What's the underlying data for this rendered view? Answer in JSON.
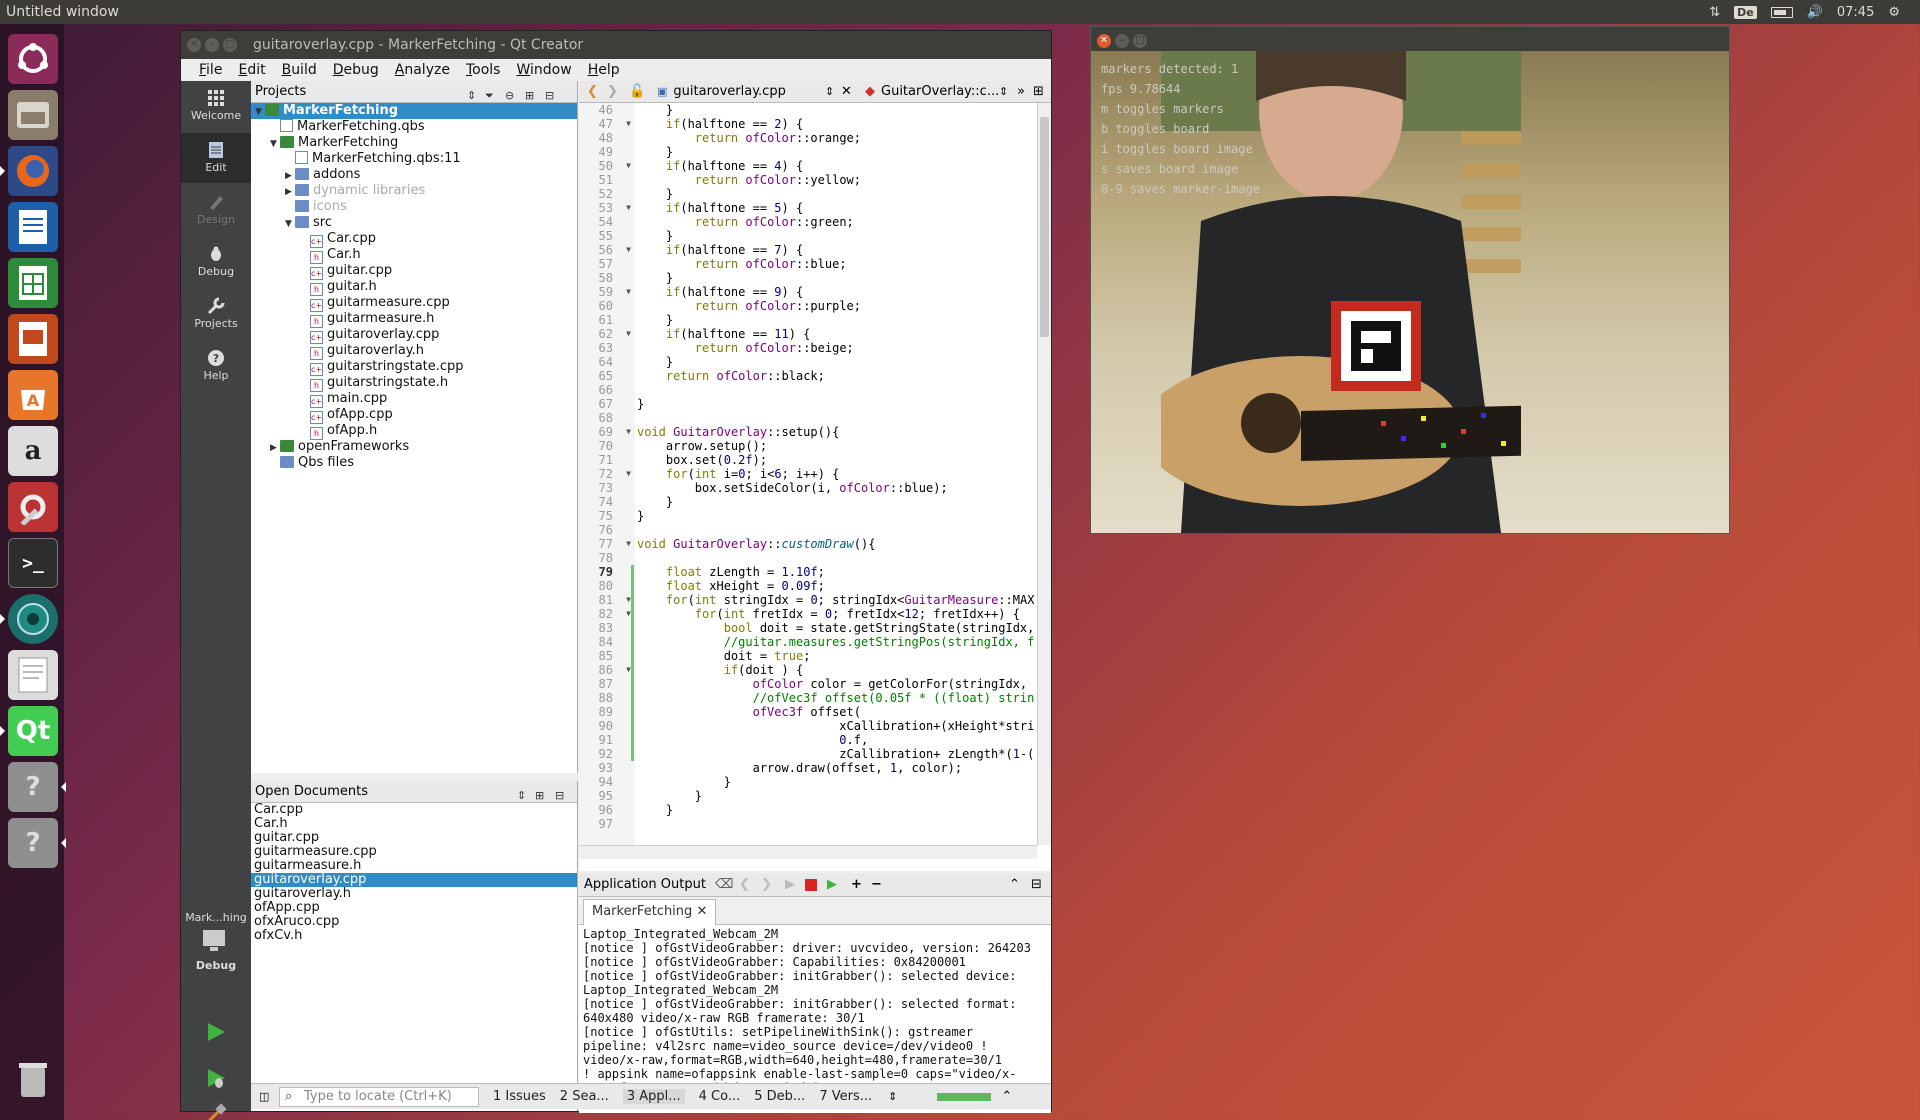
{
  "topbar": {
    "window_title": "Untitled window",
    "keyboard": "De",
    "time": "07:45"
  },
  "launcher": {
    "items": [
      "Ubuntu",
      "Files",
      "Firefox",
      "Writer",
      "Calc",
      "Impress",
      "Software",
      "Amazon",
      "Settings",
      "Terminal",
      "Qt Creator",
      "Text Editor",
      "Qt",
      "Help",
      "Help",
      "Trash"
    ]
  },
  "qt": {
    "title": "guitaroverlay.cpp - MarkerFetching - Qt Creator",
    "menu": [
      "File",
      "Edit",
      "Build",
      "Debug",
      "Analyze",
      "Tools",
      "Window",
      "Help"
    ],
    "modes": [
      "Welcome",
      "Edit",
      "Design",
      "Debug",
      "Projects",
      "Help"
    ],
    "target_kit": "Mark...hing",
    "target_mode": "Debug",
    "projects_label": "Projects",
    "tree": [
      {
        "label": "MarkerFetching",
        "level": 0,
        "sel": true,
        "tri": "▼",
        "type": "proj"
      },
      {
        "label": "MarkerFetching.qbs",
        "level": 1,
        "tri": "",
        "type": "file"
      },
      {
        "label": "MarkerFetching",
        "level": 1,
        "tri": "▼",
        "type": "proj"
      },
      {
        "label": "MarkerFetching.qbs:11",
        "level": 2,
        "tri": "",
        "type": "file"
      },
      {
        "label": "addons",
        "level": 2,
        "tri": "▶",
        "type": "folder"
      },
      {
        "label": "dynamic libraries",
        "level": 2,
        "tri": "▶",
        "type": "folder",
        "dim": true
      },
      {
        "label": "icons",
        "level": 2,
        "tri": "",
        "type": "folder",
        "dim": true
      },
      {
        "label": "src",
        "level": 2,
        "tri": "▼",
        "type": "folder"
      },
      {
        "label": "Car.cpp",
        "level": 3,
        "tri": "",
        "type": "cpp"
      },
      {
        "label": "Car.h",
        "level": 3,
        "tri": "",
        "type": "h"
      },
      {
        "label": "guitar.cpp",
        "level": 3,
        "tri": "",
        "type": "cpp"
      },
      {
        "label": "guitar.h",
        "level": 3,
        "tri": "",
        "type": "h"
      },
      {
        "label": "guitarmeasure.cpp",
        "level": 3,
        "tri": "",
        "type": "cpp"
      },
      {
        "label": "guitarmeasure.h",
        "level": 3,
        "tri": "",
        "type": "h"
      },
      {
        "label": "guitaroverlay.cpp",
        "level": 3,
        "tri": "",
        "type": "cpp"
      },
      {
        "label": "guitaroverlay.h",
        "level": 3,
        "tri": "",
        "type": "h"
      },
      {
        "label": "guitarstringstate.cpp",
        "level": 3,
        "tri": "",
        "type": "cpp"
      },
      {
        "label": "guitarstringstate.h",
        "level": 3,
        "tri": "",
        "type": "h"
      },
      {
        "label": "main.cpp",
        "level": 3,
        "tri": "",
        "type": "cpp"
      },
      {
        "label": "ofApp.cpp",
        "level": 3,
        "tri": "",
        "type": "cpp"
      },
      {
        "label": "ofApp.h",
        "level": 3,
        "tri": "",
        "type": "h"
      },
      {
        "label": "openFrameworks",
        "level": 1,
        "tri": "▶",
        "type": "proj"
      },
      {
        "label": "Qbs files",
        "level": 1,
        "tri": "",
        "type": "folder"
      }
    ],
    "open_docs_label": "Open Documents",
    "open_docs": [
      "Car.cpp",
      "Car.h",
      "guitar.cpp",
      "guitarmeasure.cpp",
      "guitarmeasure.h",
      "guitaroverlay.cpp",
      "guitaroverlay.h",
      "ofApp.cpp",
      "ofxAruco.cpp",
      "ofxCv.h"
    ],
    "open_docs_selected": 5,
    "editor_file": "guitaroverlay.cpp",
    "editor_symbol": "GuitarOverlay::c...",
    "code_lines": [
      {
        "n": "46",
        "t": "    }"
      },
      {
        "n": "47",
        "t": "    if(halftone == 2) {",
        "f": true
      },
      {
        "n": "48",
        "t": "        return ofColor::orange;"
      },
      {
        "n": "49",
        "t": "    }"
      },
      {
        "n": "50",
        "t": "    if(halftone == 4) {",
        "f": true
      },
      {
        "n": "51",
        "t": "        return ofColor::yellow;"
      },
      {
        "n": "52",
        "t": "    }"
      },
      {
        "n": "53",
        "t": "    if(halftone == 5) {",
        "f": true
      },
      {
        "n": "54",
        "t": "        return ofColor::green;"
      },
      {
        "n": "55",
        "t": "    }"
      },
      {
        "n": "56",
        "t": "    if(halftone == 7) {",
        "f": true
      },
      {
        "n": "57",
        "t": "        return ofColor::blue;"
      },
      {
        "n": "58",
        "t": "    }"
      },
      {
        "n": "59",
        "t": "    if(halftone == 9) {",
        "f": true
      },
      {
        "n": "60",
        "t": "        return ofColor::purple;"
      },
      {
        "n": "61",
        "t": "    }"
      },
      {
        "n": "62",
        "t": "    if(halftone == 11) {",
        "f": true
      },
      {
        "n": "63",
        "t": "        return ofColor::beige;"
      },
      {
        "n": "64",
        "t": "    }"
      },
      {
        "n": "65",
        "t": "    return ofColor::black;"
      },
      {
        "n": "66",
        "t": ""
      },
      {
        "n": "67",
        "t": "}"
      },
      {
        "n": "68",
        "t": ""
      },
      {
        "n": "69",
        "t": "void GuitarOverlay::setup(){",
        "f": true
      },
      {
        "n": "70",
        "t": "    arrow.setup();"
      },
      {
        "n": "71",
        "t": "    box.set(0.2f);"
      },
      {
        "n": "72",
        "t": "    for(int i=0; i<6; i++) {",
        "f": true
      },
      {
        "n": "73",
        "t": "        box.setSideColor(i, ofColor::blue);"
      },
      {
        "n": "74",
        "t": "    }"
      },
      {
        "n": "75",
        "t": "}"
      },
      {
        "n": "76",
        "t": ""
      },
      {
        "n": "77",
        "t": "void GuitarOverlay::customDraw(){",
        "f": true
      },
      {
        "n": "78",
        "t": ""
      },
      {
        "n": "79",
        "t": "    float zLength = 1.10f;",
        "cur": true
      },
      {
        "n": "80",
        "t": "    float xHeight = 0.09f;"
      },
      {
        "n": "81",
        "t": "    for(int stringIdx = 0; stringIdx<GuitarMeasure::MAX",
        "f": true
      },
      {
        "n": "82",
        "t": "        for(int fretIdx = 0; fretIdx<12; fretIdx++) {",
        "f": true
      },
      {
        "n": "83",
        "t": "            bool doit = state.getStringState(stringIdx,"
      },
      {
        "n": "84",
        "t": "            //guitar.measures.getStringPos(stringIdx, f"
      },
      {
        "n": "85",
        "t": "            doit = true;"
      },
      {
        "n": "86",
        "t": "            if(doit ) {",
        "f": true
      },
      {
        "n": "87",
        "t": "                ofColor color = getColorFor(stringIdx,"
      },
      {
        "n": "88",
        "t": "                //ofVec3f offset(0.05f * ((float) strin"
      },
      {
        "n": "89",
        "t": "                ofVec3f offset("
      },
      {
        "n": "90",
        "t": "                            xCallibration+(xHeight*stri"
      },
      {
        "n": "91",
        "t": "                            0.f,"
      },
      {
        "n": "92",
        "t": "                            zCallibration+ zLength*(1-("
      },
      {
        "n": "93",
        "t": "                arrow.draw(offset, 1, color);"
      },
      {
        "n": "94",
        "t": "            }"
      },
      {
        "n": "95",
        "t": "        }"
      },
      {
        "n": "96",
        "t": "    }"
      },
      {
        "n": "97",
        "t": ""
      }
    ],
    "output_label": "Application Output",
    "output_tab": "MarkerFetching",
    "output_lines": [
      "Laptop_Integrated_Webcam_2M",
      "[notice ] ofGstVideoGrabber: driver: uvcvideo, version: 264203",
      "[notice ] ofGstVideoGrabber: Capabilities: 0x84200001",
      "[notice ] ofGstVideoGrabber: initGrabber(): selected device:",
      "Laptop_Integrated_Webcam_2M",
      "[notice ] ofGstVideoGrabber: initGrabber(): selected format:",
      "640x480 video/x-raw RGB framerate: 30/1",
      "[notice ] ofGstUtils: setPipelineWithSink(): gstreamer",
      "pipeline: v4l2src name=video_source device=/dev/video0 !",
      "video/x-raw,format=RGB,width=640,height=480,framerate=30/1",
      "! appsink name=ofappsink enable-last-sample=0 caps=\"video/x-",
      "raw, format=RGB, width=640, height=480\""
    ],
    "locator_placeholder": "Type to locate (Ctrl+K)",
    "status_tabs": [
      "1  Issues",
      "2  Sea...",
      "3  Appl...",
      "4  Co...",
      "5  Deb...",
      "7  Vers..."
    ]
  },
  "cam": {
    "overlay_lines": [
      "markers detected: 1",
      "fps 9.78644",
      "m toggles markers",
      "b toggles board",
      "i toggles board image",
      "s saves board image",
      "0-9 saves marker-image"
    ]
  }
}
